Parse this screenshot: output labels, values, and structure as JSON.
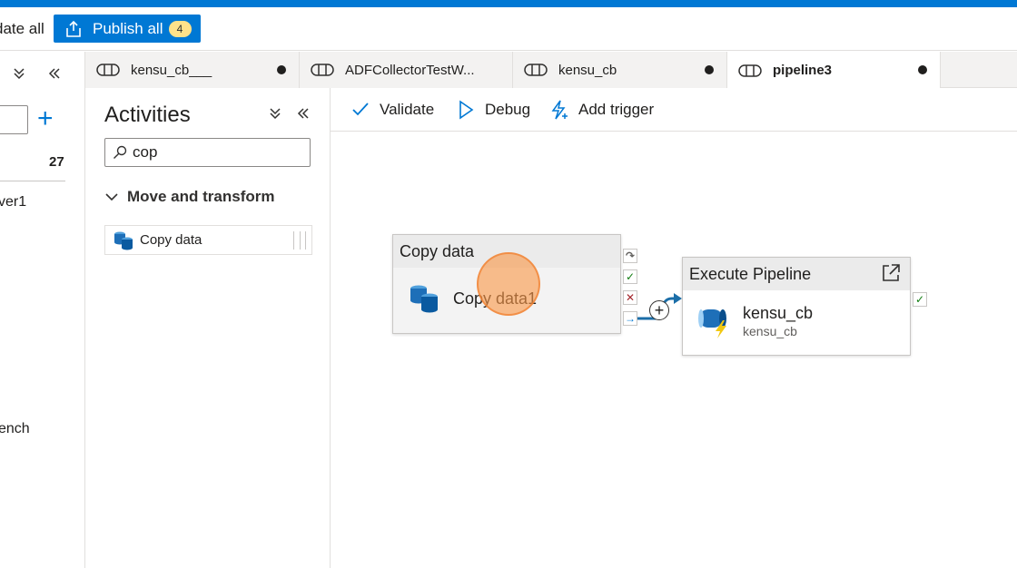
{
  "toolbar": {
    "validate_all_label": "date all",
    "publish_label": "Publish all",
    "publish_badge": "4"
  },
  "explorer": {
    "count": "27",
    "item1": "ver1",
    "item2": "ench"
  },
  "tabs": [
    {
      "label": "kensu_cb___",
      "unsaved": true
    },
    {
      "label": "ADFCollectorTestW...",
      "unsaved": false
    },
    {
      "label": "kensu_cb",
      "unsaved": true
    },
    {
      "label": "pipeline3",
      "unsaved": true,
      "active": true
    }
  ],
  "activities": {
    "title": "Activities",
    "search_value": "cop",
    "category": "Move and transform",
    "item": "Copy data"
  },
  "canvas_toolbar": {
    "validate": "Validate",
    "debug": "Debug",
    "add_trigger": "Add trigger"
  },
  "nodes": {
    "copy": {
      "header": "Copy data",
      "name": "Copy data1"
    },
    "execute": {
      "header": "Execute Pipeline",
      "name": "kensu_cb",
      "sub": "kensu_cb"
    }
  },
  "colors": {
    "accent": "#0078d4",
    "success": "#107c10",
    "failure": "#a4262c",
    "badge": "#ffe28a"
  }
}
